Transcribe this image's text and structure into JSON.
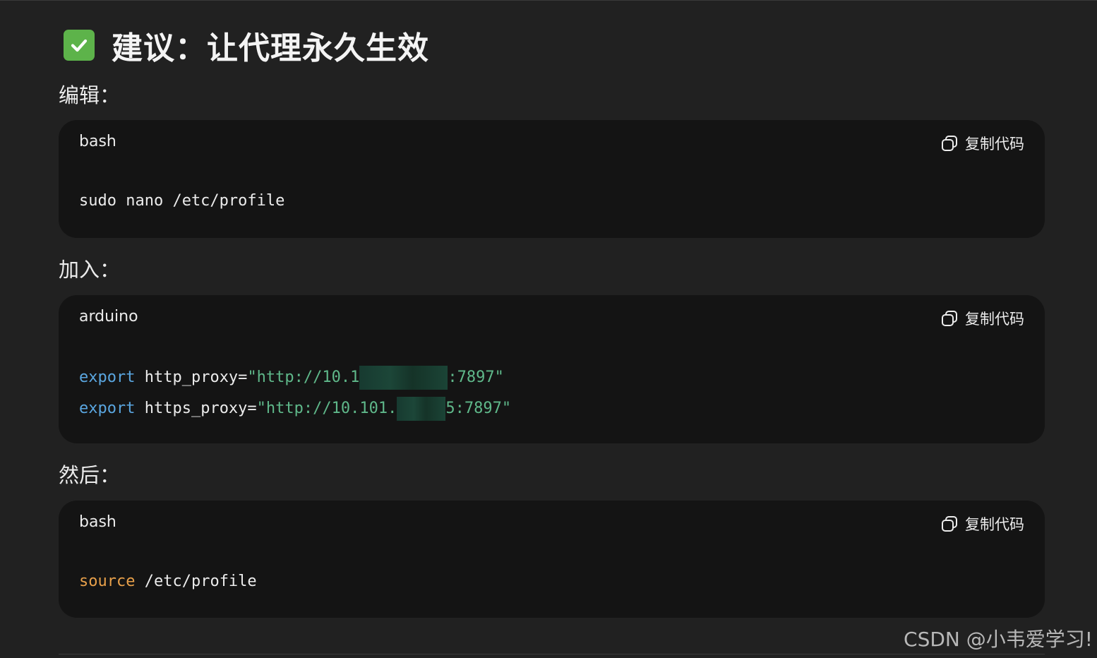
{
  "heading": {
    "icon": "check-mark-button-icon",
    "text": "建议：让代理永久生效"
  },
  "sections": [
    {
      "label": "编辑：",
      "lang": "bash",
      "copy_label": "复制代码",
      "lines": [
        [
          "sudo nano /etc/profile"
        ]
      ]
    },
    {
      "label": "加入：",
      "lang": "arduino",
      "copy_label": "复制代码",
      "lines": [
        [
          "export",
          " http_proxy=",
          "\"http://10.1",
          ":7897\""
        ],
        [
          "export",
          " https_proxy=",
          "\"http://10.101.",
          "5:7897\""
        ]
      ]
    },
    {
      "label": "然后：",
      "lang": "bash",
      "copy_label": "复制代码",
      "lines": [
        [
          "source",
          " /etc/profile"
        ]
      ]
    }
  ],
  "watermark": "CSDN @小韦爱学习!",
  "colors": {
    "background": "#212121",
    "code_background": "#141414",
    "keyword_blue": "#5aa6e0",
    "keyword_orange": "#e8a04a",
    "string_green": "#5fb88a",
    "check_green": "#5db34a"
  }
}
